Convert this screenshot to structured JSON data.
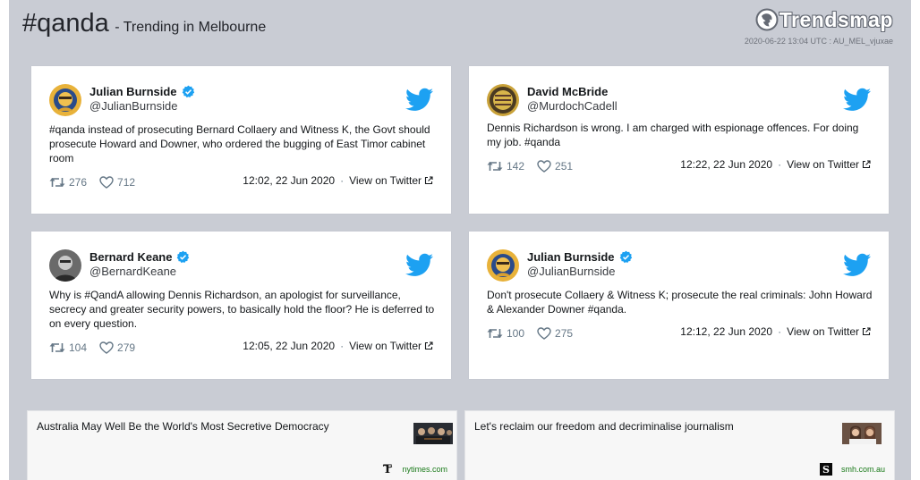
{
  "header": {
    "hashtag": "#qanda",
    "subtitle": "- Trending in Melbourne",
    "brand": "Trendsmap",
    "meta": "2020-06-22 13:04 UTC : AU_MEL_vjuxae"
  },
  "tweets": [
    {
      "name": "Julian Burnside",
      "handle": "@JulianBurnside",
      "verified": true,
      "text": "#qanda instead of prosecuting Bernard Collaery and Witness K, the Govt should prosecute Howard and Downer, who ordered the bugging of East Timor cabinet room",
      "retweets": "276",
      "likes": "712",
      "time": "12:02, 22 Jun 2020",
      "view": "View on Twitter"
    },
    {
      "name": "David McBride",
      "handle": "@MurdochCadell",
      "verified": false,
      "text": "Dennis Richardson is wrong. I am charged with espionage offences. For doing my job. #qanda",
      "retweets": "142",
      "likes": "251",
      "time": "12:22, 22 Jun 2020",
      "view": "View on Twitter"
    },
    {
      "name": "Bernard Keane",
      "handle": "@BernardKeane",
      "verified": true,
      "text": "Why is #QandA allowing Dennis Richardson, an apologist for surveillance, secrecy and greater security powers, to basically hold the floor? He is deferred to on every question.",
      "retweets": "104",
      "likes": "279",
      "time": "12:05, 22 Jun 2020",
      "view": "View on Twitter"
    },
    {
      "name": "Julian Burnside",
      "handle": "@JulianBurnside",
      "verified": true,
      "text": "Don't prosecute Collaery & Witness K; prosecute the real criminals: John Howard & Alexander Downer #qanda.",
      "retweets": "100",
      "likes": "275",
      "time": "12:12, 22 Jun 2020",
      "view": "View on Twitter"
    }
  ],
  "news": [
    {
      "title": "Australia May Well Be the World's Most Secretive Democracy",
      "source": "nytimes.com"
    },
    {
      "title": "Let's reclaim our freedom and decriminalise journalism",
      "source": "smh.com.au"
    }
  ],
  "colors": {
    "twitter_blue": "#1da1f2",
    "background": "#c9ccd4",
    "source_green": "#1a7a1a"
  },
  "icons": [
    "trendsmap-logo-icon",
    "verified-icon",
    "twitter-bird-icon",
    "retweet-icon",
    "heart-icon",
    "external-link-icon",
    "nytimes-icon",
    "smh-icon"
  ]
}
